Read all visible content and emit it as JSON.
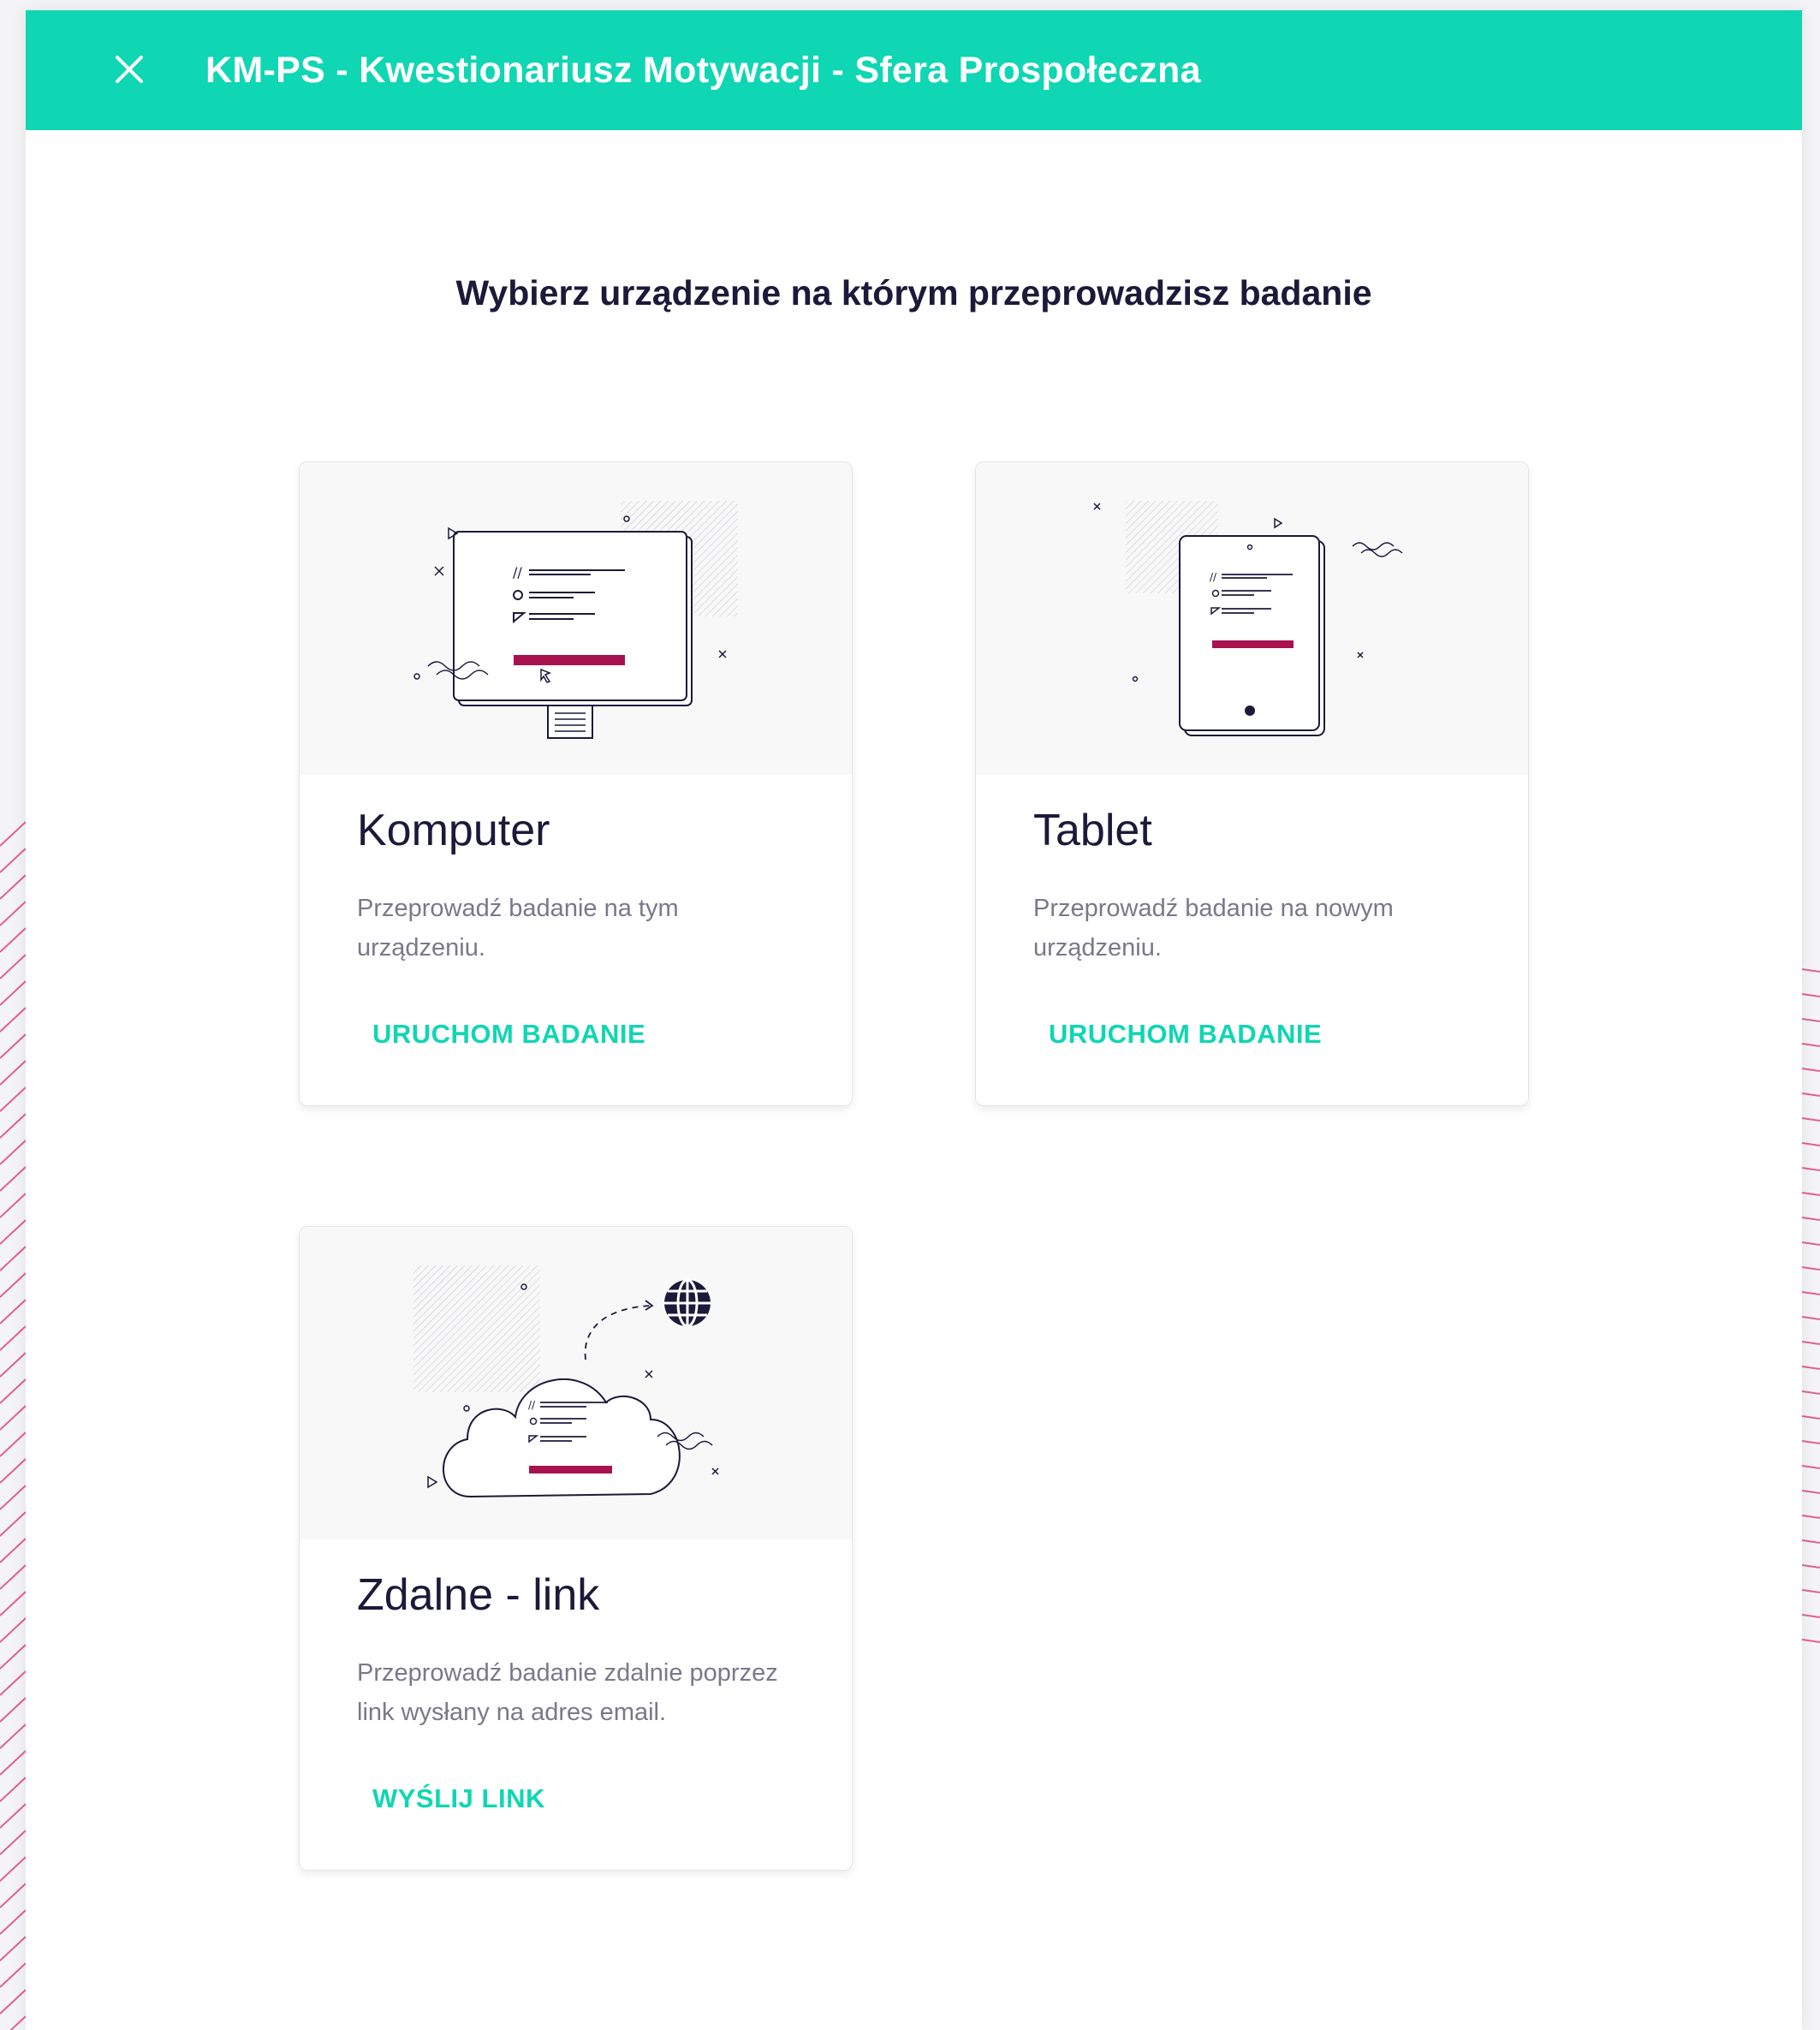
{
  "header": {
    "title": "KM-PS - Kwestionariusz Motywacji - Sfera Prospołeczna",
    "close_icon": "close-icon"
  },
  "main": {
    "heading": "Wybierz urządzenie na którym przeprowadzisz badanie",
    "cards": [
      {
        "title": "Komputer",
        "description": "Przeprowadź badanie na tym urządzeniu.",
        "action": "URUCHOM BADANIE",
        "illustration": "computer-illustration"
      },
      {
        "title": "Tablet",
        "description": "Przeprowadź badanie na nowym urządzeniu.",
        "action": "URUCHOM BADANIE",
        "illustration": "tablet-illustration"
      },
      {
        "title": "Zdalne - link",
        "description": "Przeprowadź badanie zdalnie poprzez link wysłany na adres email.",
        "action": "WYŚLIJ LINK",
        "illustration": "cloud-illustration"
      }
    ]
  },
  "colors": {
    "accent": "#0fd6b3",
    "text_dark": "#1c1a3a",
    "text_muted": "#7a788a",
    "highlight_bar": "#a8124f",
    "decor_lines": "#e0628e"
  }
}
